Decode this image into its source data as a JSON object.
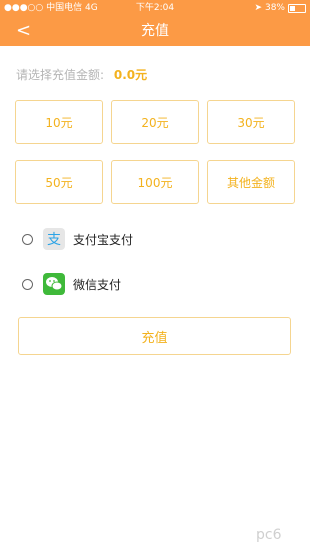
{
  "status_bar": {
    "carrier": "●●●○○ 中国电信 4G",
    "time": "下午2:04",
    "battery": "38%"
  },
  "header": {
    "back_icon": "<",
    "title": "充值"
  },
  "prompt": {
    "label": "请选择充值金额:",
    "amount": "0.0元"
  },
  "amounts": [
    "10元",
    "20元",
    "30元",
    "50元",
    "100元",
    "其他金额"
  ],
  "payment": {
    "alipay_label": "支付宝支付",
    "wechat_label": "微信支付"
  },
  "charge_button": "充值",
  "colors": {
    "header": "#fc9a45",
    "accent": "#f3b21e",
    "border": "#f5d590"
  }
}
